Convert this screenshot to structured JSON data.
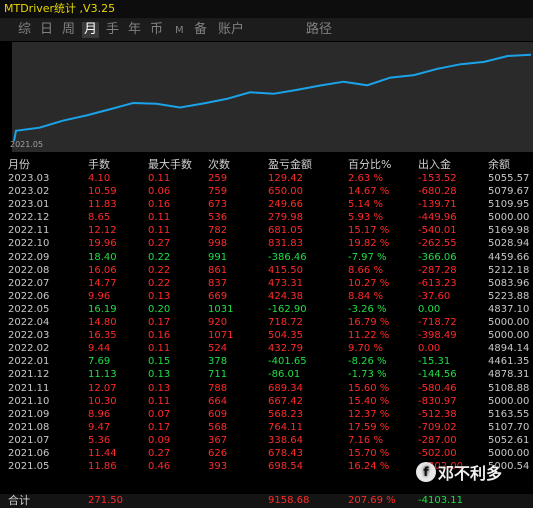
{
  "title": "MTDriver统计 ,V3.25",
  "tabs": [
    "综",
    "日",
    "周",
    "月",
    "手",
    "年",
    "币",
    "M",
    "备",
    "账户",
    "路径"
  ],
  "active_tab": "月",
  "chart_data": {
    "type": "line",
    "x_start_label": "2021.05",
    "series": [
      {
        "values": [
          5000.54,
          5052.61,
          5107.7,
          5163.55,
          5000.0,
          5108.88,
          4878.31,
          4461.35,
          4894.14,
          5000.0,
          5000.0,
          4837.1,
          5223.88,
          5083.96,
          5212.18,
          4459.66,
          5028.94,
          5000.0,
          5169.98,
          5000.0,
          5109.95,
          5079.67,
          5055.57
        ],
        "cumulative_profit": [
          698.54,
          1037.18,
          1801.29,
          2369.52,
          3036.94,
          3726.28,
          3640.27,
          3238.62,
          3671.41,
          4175.76,
          4894.48,
          4731.58,
          5156.02,
          5629.33,
          6044.83,
          5658.37,
          6490.2,
          6770.18,
          7451.23,
          7950.49,
          8200.15,
          8850.15,
          8979.57
        ]
      }
    ],
    "line_color": "#1aa3e8"
  },
  "headers": [
    "月份",
    "手数",
    "最大手数",
    "次数",
    "盈亏金额",
    "百分比%",
    "出入金",
    "余额"
  ],
  "rows": [
    {
      "month": "2023.03",
      "lots": "4.10",
      "max": "0.11",
      "count": "259",
      "pnl": "129.42",
      "pct": "2.63 %",
      "flow": "-153.52",
      "bal": "5055.57",
      "pos": false
    },
    {
      "month": "2023.02",
      "lots": "10.59",
      "max": "0.06",
      "count": "759",
      "pnl": "650.00",
      "pct": "14.67 %",
      "flow": "-680.28",
      "bal": "5079.67",
      "pos": false
    },
    {
      "month": "2023.01",
      "lots": "11.83",
      "max": "0.16",
      "count": "673",
      "pnl": "249.66",
      "pct": "5.14 %",
      "flow": "-139.71",
      "bal": "5109.95",
      "pos": false
    },
    {
      "month": "2022.12",
      "lots": "8.65",
      "max": "0.11",
      "count": "536",
      "pnl": "279.98",
      "pct": "5.93 %",
      "flow": "-449.96",
      "bal": "5000.00",
      "pos": false
    },
    {
      "month": "2022.11",
      "lots": "12.12",
      "max": "0.11",
      "count": "782",
      "pnl": "681.05",
      "pct": "15.17 %",
      "flow": "-540.01",
      "bal": "5169.98",
      "pos": false
    },
    {
      "month": "2022.10",
      "lots": "19.96",
      "max": "0.27",
      "count": "998",
      "pnl": "831.83",
      "pct": "19.82 %",
      "flow": "-262.55",
      "bal": "5028.94",
      "pos": false
    },
    {
      "month": "2022.09",
      "lots": "18.40",
      "max": "0.22",
      "count": "991",
      "pnl": "-386.46",
      "pct": "-7.97 %",
      "flow": "-366.06",
      "bal": "4459.66",
      "pos": true
    },
    {
      "month": "2022.08",
      "lots": "16.06",
      "max": "0.22",
      "count": "861",
      "pnl": "415.50",
      "pct": "8.66 %",
      "flow": "-287.28",
      "bal": "5212.18",
      "pos": false
    },
    {
      "month": "2022.07",
      "lots": "14.77",
      "max": "0.22",
      "count": "837",
      "pnl": "473.31",
      "pct": "10.27 %",
      "flow": "-613.23",
      "bal": "5083.96",
      "pos": false
    },
    {
      "month": "2022.06",
      "lots": "9.96",
      "max": "0.13",
      "count": "669",
      "pnl": "424.38",
      "pct": "8.84 %",
      "flow": "-37.60",
      "bal": "5223.88",
      "pos": false
    },
    {
      "month": "2022.05",
      "lots": "16.19",
      "max": "0.20",
      "count": "1031",
      "pnl": "-162.90",
      "pct": "-3.26 %",
      "flow": "0.00",
      "bal": "4837.10",
      "pos": true
    },
    {
      "month": "2022.04",
      "lots": "14.80",
      "max": "0.17",
      "count": "920",
      "pnl": "718.72",
      "pct": "16.79 %",
      "flow": "-718.72",
      "bal": "5000.00",
      "pos": false
    },
    {
      "month": "2022.03",
      "lots": "16.35",
      "max": "0.16",
      "count": "1071",
      "pnl": "504.35",
      "pct": "11.22 %",
      "flow": "-398.49",
      "bal": "5000.00",
      "pos": false
    },
    {
      "month": "2022.02",
      "lots": "9.44",
      "max": "0.11",
      "count": "524",
      "pnl": "432.79",
      "pct": "9.70 %",
      "flow": "0.00",
      "bal": "4894.14",
      "pos": false
    },
    {
      "month": "2022.01",
      "lots": "7.69",
      "max": "0.15",
      "count": "378",
      "pnl": "-401.65",
      "pct": "-8.26 %",
      "flow": "-15.31",
      "bal": "4461.35",
      "pos": true
    },
    {
      "month": "2021.12",
      "lots": "11.13",
      "max": "0.13",
      "count": "711",
      "pnl": "-86.01",
      "pct": "-1.73 %",
      "flow": "-144.56",
      "bal": "4878.31",
      "pos": true
    },
    {
      "month": "2021.11",
      "lots": "12.07",
      "max": "0.13",
      "count": "788",
      "pnl": "689.34",
      "pct": "15.60 %",
      "flow": "-580.46",
      "bal": "5108.88",
      "pos": false
    },
    {
      "month": "2021.10",
      "lots": "10.30",
      "max": "0.11",
      "count": "664",
      "pnl": "667.42",
      "pct": "15.40 %",
      "flow": "-830.97",
      "bal": "5000.00",
      "pos": false
    },
    {
      "month": "2021.09",
      "lots": "8.96",
      "max": "0.07",
      "count": "609",
      "pnl": "568.23",
      "pct": "12.37 %",
      "flow": "-512.38",
      "bal": "5163.55",
      "pos": false
    },
    {
      "month": "2021.08",
      "lots": "9.47",
      "max": "0.17",
      "count": "568",
      "pnl": "764.11",
      "pct": "17.59 %",
      "flow": "-709.02",
      "bal": "5107.70",
      "pos": false
    },
    {
      "month": "2021.07",
      "lots": "5.36",
      "max": "0.09",
      "count": "367",
      "pnl": "338.64",
      "pct": "7.16 %",
      "flow": "-287.00",
      "bal": "5052.61",
      "pos": false
    },
    {
      "month": "2021.06",
      "lots": "11.44",
      "max": "0.27",
      "count": "626",
      "pnl": "678.43",
      "pct": "15.70 %",
      "flow": "-502.00",
      "bal": "5000.00",
      "pos": false
    },
    {
      "month": "2021.05",
      "lots": "11.86",
      "max": "0.46",
      "count": "393",
      "pnl": "698.54",
      "pct": "16.24 %",
      "flow": "-4302.00",
      "bal": "5000.54",
      "pos": false
    }
  ],
  "total": {
    "label": "合计",
    "lots": "271.50",
    "pnl": "9158.68",
    "pct": "207.69 %",
    "flow": "-4103.11"
  },
  "watermark": {
    "logo": "f",
    "text": "邓不利多"
  }
}
